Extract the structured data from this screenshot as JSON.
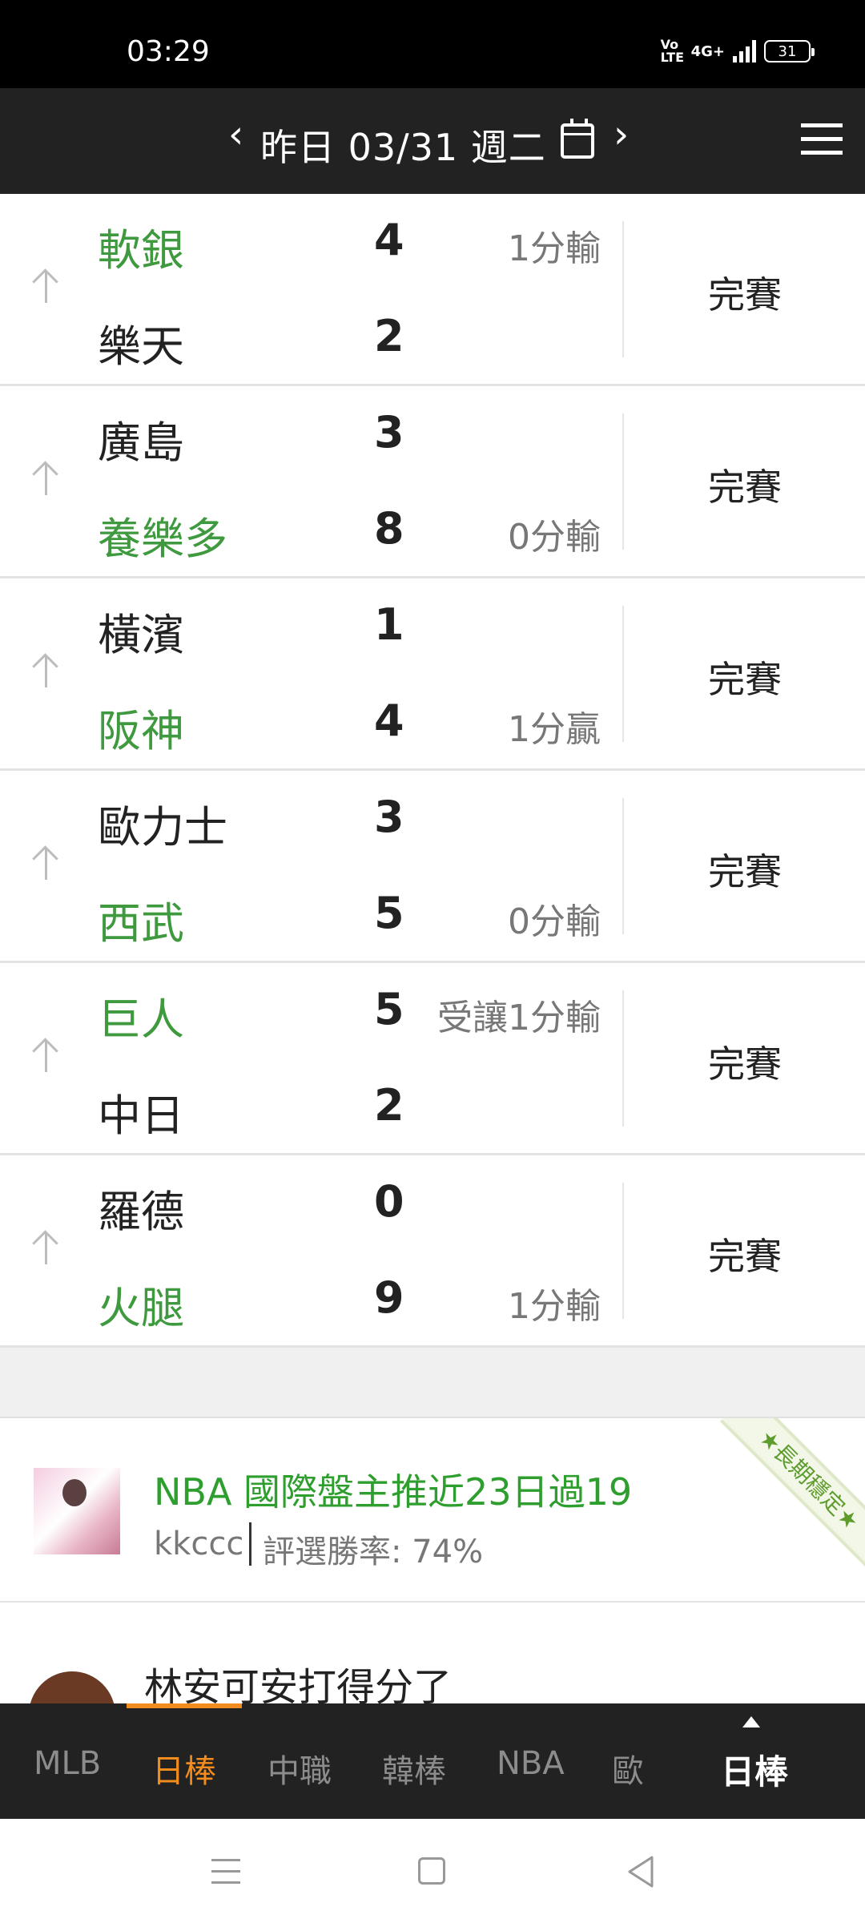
{
  "status_bar": {
    "time": "03:29",
    "volte": "Vo LTE",
    "network": "4G+",
    "battery": "31"
  },
  "header": {
    "prev_icon": "chevron-left-icon",
    "title": "昨日 03/31 週二",
    "calendar_icon": "calendar-icon",
    "next_icon": "chevron-right-icon",
    "menu_icon": "hamburger-menu-icon"
  },
  "games": [
    {
      "away": "軟銀",
      "away_score": "4",
      "home": "樂天",
      "home_score": "2",
      "away_note": "1分輸",
      "home_note": "",
      "status": "完賽",
      "green": "away"
    },
    {
      "away": "廣島",
      "away_score": "3",
      "home": "養樂多",
      "home_score": "8",
      "away_note": "",
      "home_note": "0分輸",
      "status": "完賽",
      "green": "home"
    },
    {
      "away": "橫濱",
      "away_score": "1",
      "home": "阪神",
      "home_score": "4",
      "away_note": "",
      "home_note": "1分贏",
      "status": "完賽",
      "green": "home"
    },
    {
      "away": "歐力士",
      "away_score": "3",
      "home": "西武",
      "home_score": "5",
      "away_note": "",
      "home_note": "0分輸",
      "status": "完賽",
      "green": "home"
    },
    {
      "away": "巨人",
      "away_score": "5",
      "home": "中日",
      "home_score": "2",
      "away_note": "受讓1分輸",
      "home_note": "",
      "status": "完賽",
      "green": "away"
    },
    {
      "away": "羅德",
      "away_score": "0",
      "home": "火腿",
      "home_score": "9",
      "away_note": "",
      "home_note": "1分輸",
      "status": "完賽",
      "green": "home"
    }
  ],
  "promo": {
    "title": "NBA 國際盤主推近23日過19",
    "author": "kkccc",
    "rate": "評選勝率: 74%",
    "ribbon": "★長期穩定★"
  },
  "article": {
    "title": "林安可安打得分了"
  },
  "tabs": {
    "items": [
      "MLB",
      "日棒",
      "中職",
      "韓棒",
      "NBA",
      "歐"
    ],
    "active": "日棒",
    "current_label": "日棒"
  },
  "colors": {
    "header_bg": "#222222",
    "winner_green": "#3f9a3f",
    "accent_orange": "#f28c1e"
  }
}
